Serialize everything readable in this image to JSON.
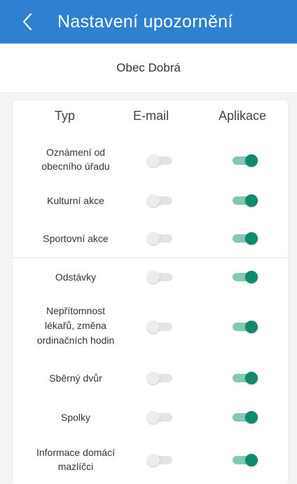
{
  "appbar": {
    "title": "Nastavení upozornění",
    "back_icon": "chevron-left-icon"
  },
  "subheader": {
    "municipality": "Obec Dobrá"
  },
  "table": {
    "col_type": "Typ",
    "col_email": "E-mail",
    "col_app": "Aplikace",
    "rows": [
      {
        "line1": "Oznámení od",
        "line2": "obecního úřadu",
        "line3": "",
        "email": false,
        "app": true
      },
      {
        "line1": "Kulturní akce",
        "line2": "",
        "line3": "",
        "email": false,
        "app": true
      },
      {
        "line1": "Sportovní akce",
        "line2": "",
        "line3": "",
        "email": false,
        "app": true
      },
      {
        "line1": "Odstávky",
        "line2": "",
        "line3": "",
        "email": false,
        "app": true
      },
      {
        "line1": "Nepřítomnost",
        "line2": "lékařů, změna",
        "line3": "ordinačních hodin",
        "email": false,
        "app": true
      },
      {
        "line1": "Sběrný dvůr",
        "line2": "",
        "line3": "",
        "email": false,
        "app": true
      },
      {
        "line1": "Spolky",
        "line2": "",
        "line3": "",
        "email": false,
        "app": true
      },
      {
        "line1": "Informace domácí",
        "line2": "mazlíčci",
        "line3": "",
        "email": false,
        "app": true
      }
    ]
  },
  "colors": {
    "appbar": "#2f80d0",
    "toggle_on": "#0f8a6c",
    "toggle_on_track": "#83c8b3",
    "toggle_off": "#ececec"
  }
}
